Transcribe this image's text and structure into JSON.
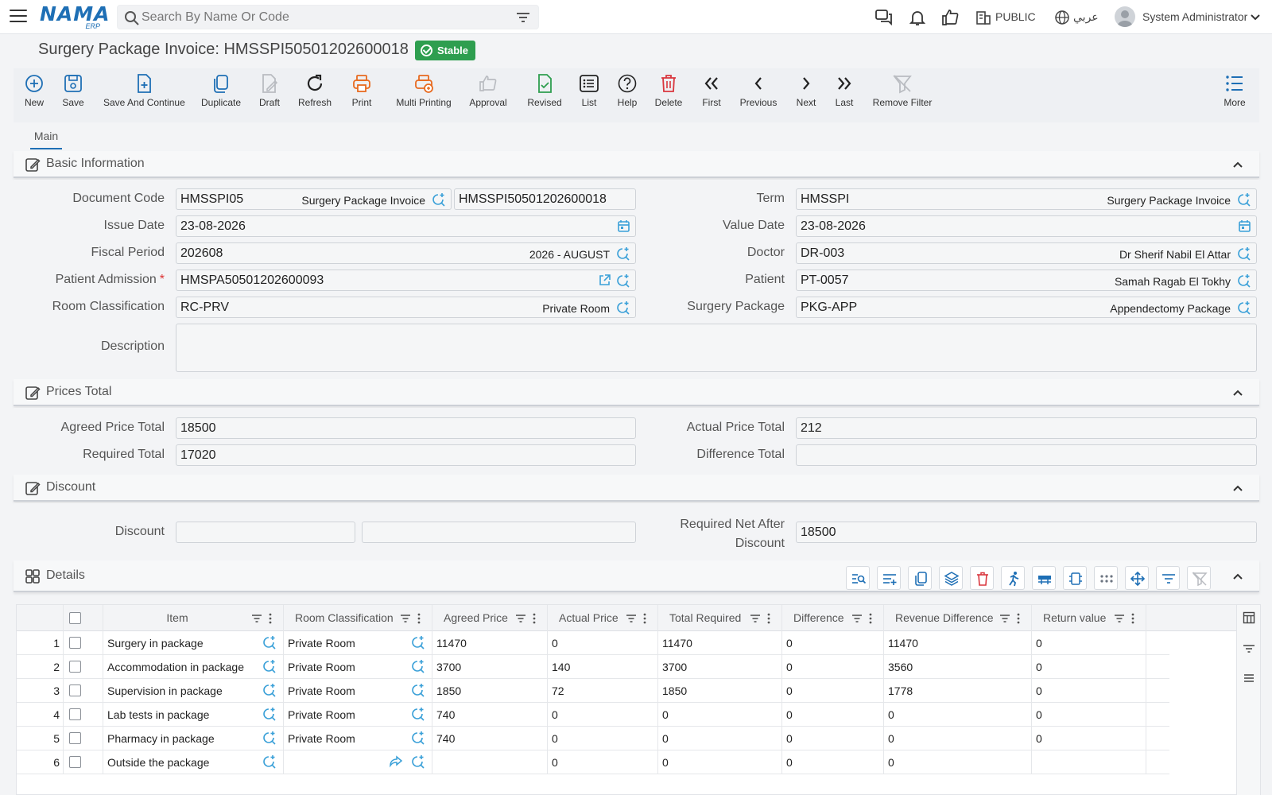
{
  "topbar": {
    "logo_text": "NAMA",
    "logo_sub": "ERP",
    "search_placeholder": "Search By Name Or Code",
    "public_label": "PUBLIC",
    "language_label": "عربي",
    "user_name": "System Administrator"
  },
  "page": {
    "title": "Surgery Package Invoice: HMSSPI50501202600018",
    "status": "Stable"
  },
  "toolbar": {
    "new": "New",
    "save": "Save",
    "save_continue": "Save And Continue",
    "duplicate": "Duplicate",
    "draft": "Draft",
    "refresh": "Refresh",
    "print": "Print",
    "multi_printing": "Multi Printing",
    "approval": "Approval",
    "revised": "Revised",
    "list": "List",
    "help": "Help",
    "delete": "Delete",
    "first": "First",
    "previous": "Previous",
    "next": "Next",
    "last": "Last",
    "remove_filter": "Remove Filter",
    "more": "More"
  },
  "tabs": {
    "main": "Main"
  },
  "basic": {
    "section_title": "Basic Information",
    "document_code_label": "Document Code",
    "document_code_value": "HMSSPI05",
    "document_code_desc": "Surgery Package Invoice",
    "document_number": "HMSSPI50501202600018",
    "term_label": "Term",
    "term_value": "HMSSPI",
    "term_desc": "Surgery Package Invoice",
    "issue_date_label": "Issue Date",
    "issue_date_value": "23-08-2026",
    "value_date_label": "Value Date",
    "value_date_value": "23-08-2026",
    "fiscal_period_label": "Fiscal Period",
    "fiscal_period_value": "202608",
    "fiscal_period_desc": "2026 - AUGUST",
    "doctor_label": "Doctor",
    "doctor_value": "DR-003",
    "doctor_desc": "Dr Sherif Nabil El Attar",
    "patient_admission_label": "Patient Admission",
    "required_mark": "*",
    "patient_admission_value": "HMSPA50501202600093",
    "patient_label": "Patient",
    "patient_value": "PT-0057",
    "patient_desc": "Samah Ragab El Tokhy",
    "room_class_label": "Room Classification",
    "room_class_value": "RC-PRV",
    "room_class_desc": "Private Room",
    "surgery_package_label": "Surgery Package",
    "surgery_package_value": "PKG-APP",
    "surgery_package_desc": "Appendectomy Package",
    "description_label": "Description",
    "description_value": ""
  },
  "prices": {
    "section_title": "Prices Total",
    "agreed_label": "Agreed Price Total",
    "agreed_value": "18500",
    "actual_label": "Actual Price Total",
    "actual_value": "212",
    "required_label": "Required Total",
    "required_value": "17020",
    "difference_label": "Difference Total",
    "difference_value": ""
  },
  "discount": {
    "section_title": "Discount",
    "discount_label": "Discount",
    "discount_value_1": "",
    "discount_value_2": "",
    "required_net_label_1": "Required Net After",
    "required_net_label_2": "Discount",
    "required_net_value": "18500"
  },
  "details": {
    "section_title": "Details",
    "columns": [
      "Item",
      "Room Classification",
      "Agreed Price",
      "Actual Price",
      "Total Required",
      "Difference",
      "Revenue Difference",
      "Return value"
    ],
    "rows": [
      {
        "n": "1",
        "item": "Surgery in package",
        "room": "Private Room",
        "agreed": "11470",
        "actual": "0",
        "total": "11470",
        "diff": "0",
        "rev": "11470",
        "ret": "0"
      },
      {
        "n": "2",
        "item": "Accommodation in package",
        "room": "Private Room",
        "agreed": "3700",
        "actual": "140",
        "total": "3700",
        "diff": "0",
        "rev": "3560",
        "ret": "0"
      },
      {
        "n": "3",
        "item": "Supervision in package",
        "room": "Private Room",
        "agreed": "1850",
        "actual": "72",
        "total": "1850",
        "diff": "0",
        "rev": "1778",
        "ret": "0"
      },
      {
        "n": "4",
        "item": "Lab tests in package",
        "room": "Private Room",
        "agreed": "740",
        "actual": "0",
        "total": "0",
        "diff": "0",
        "rev": "0",
        "ret": "0"
      },
      {
        "n": "5",
        "item": "Pharmacy in package",
        "room": "Private Room",
        "agreed": "740",
        "actual": "0",
        "total": "0",
        "diff": "0",
        "rev": "0",
        "ret": "0"
      },
      {
        "n": "6",
        "item": "Outside the package",
        "room": "",
        "agreed": "",
        "actual": "0",
        "total": "0",
        "diff": "0",
        "rev": "0",
        "ret": ""
      }
    ]
  },
  "colors": {
    "brand": "#1e6fb5",
    "status_green": "#2e9e4f",
    "delete_red": "#d9363e",
    "print_orange": "#e86a1f"
  }
}
